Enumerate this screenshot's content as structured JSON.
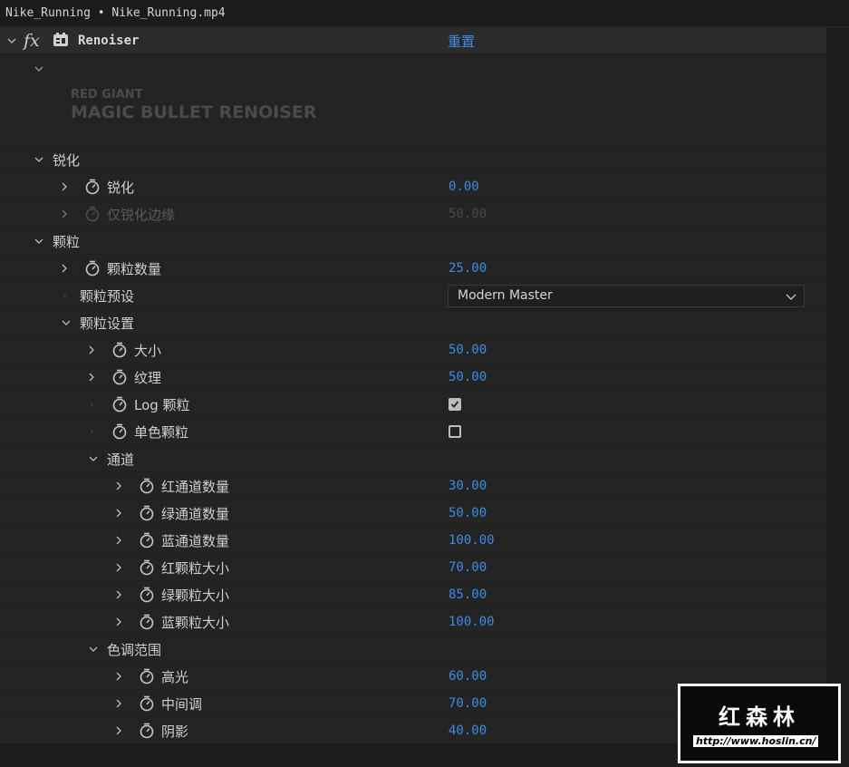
{
  "window": {
    "title": "Nike_Running • Nike_Running.mp4"
  },
  "effect": {
    "name": "Renoiser",
    "fx_label": "fx",
    "reset_label": "重置"
  },
  "logo": {
    "line1": "RED GIANT",
    "line2": "MAGIC BULLET RENOISER"
  },
  "sections": {
    "sharpen": {
      "label": "锐化",
      "sharpen": {
        "label": "锐化",
        "value": "0.00"
      },
      "edges_only": {
        "label": "仅锐化边缘",
        "value": "50.00"
      }
    },
    "grain": {
      "label": "颗粒",
      "amount": {
        "label": "颗粒数量",
        "value": "25.00"
      },
      "preset": {
        "label": "颗粒预设",
        "selected": "Modern Master"
      },
      "settings": {
        "label": "颗粒设置",
        "size": {
          "label": "大小",
          "value": "50.00"
        },
        "texture": {
          "label": "纹理",
          "value": "50.00"
        },
        "log_grain": {
          "label": "Log 颗粒",
          "checked": true
        },
        "mono_grain": {
          "label": "单色颗粒",
          "checked": false
        },
        "channels": {
          "label": "通道",
          "red_amount": {
            "label": "红通道数量",
            "value": "30.00"
          },
          "green_amount": {
            "label": "绿通道数量",
            "value": "50.00"
          },
          "blue_amount": {
            "label": "蓝通道数量",
            "value": "100.00"
          },
          "red_size": {
            "label": "红颗粒大小",
            "value": "70.00"
          },
          "green_size": {
            "label": "绿颗粒大小",
            "value": "85.00"
          },
          "blue_size": {
            "label": "蓝颗粒大小",
            "value": "100.00"
          }
        },
        "tonal": {
          "label": "色调范围",
          "highlights": {
            "label": "高光",
            "value": "60.00"
          },
          "midtones": {
            "label": "中间调",
            "value": "70.00"
          },
          "shadows": {
            "label": "阴影",
            "value": "40.00"
          }
        }
      }
    }
  },
  "watermark": {
    "title": "红森林",
    "url": "http://www.hoslin.cn/"
  },
  "colors": {
    "accent": "#3a8ee6",
    "background": "#232323"
  }
}
